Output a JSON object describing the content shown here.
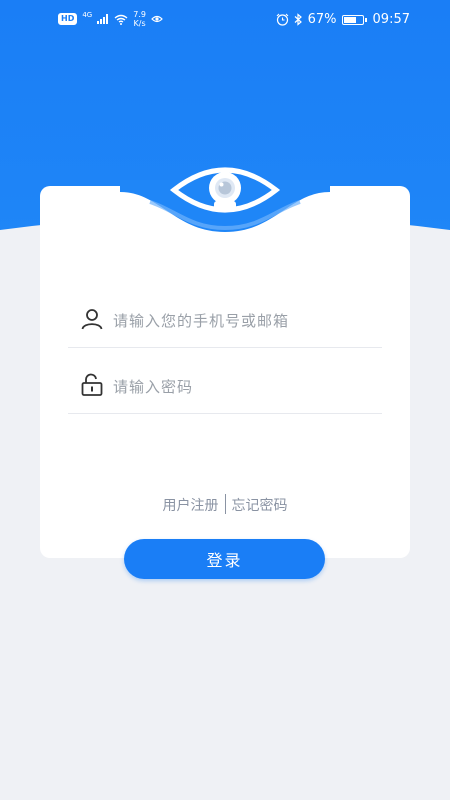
{
  "status_bar": {
    "hd": "HD",
    "network": "4G",
    "speed_value": "7.9",
    "speed_unit": "K/s",
    "battery": "67%",
    "time": "09:57"
  },
  "login": {
    "account_placeholder": "请输入您的手机号或邮箱",
    "password_placeholder": "请输入密码",
    "register_link": "用户注册",
    "forgot_link": "忘记密码",
    "login_button": "登录"
  },
  "colors": {
    "primary": "#1a7ef6",
    "background": "#eff1f5",
    "placeholder": "#9aa0a8",
    "link": "#8a93a3"
  }
}
